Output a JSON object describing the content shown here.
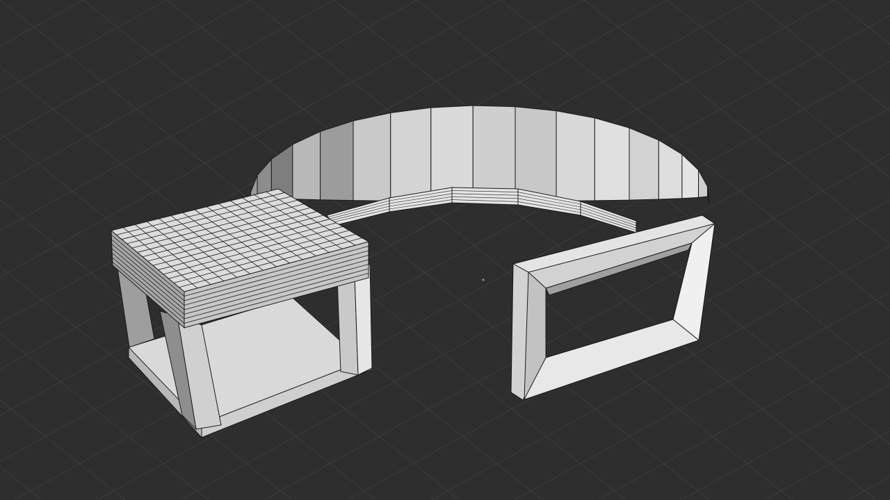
{
  "viewport": {
    "background": "#2e2e2e",
    "grid_line_color": "#3c3c3c"
  },
  "scene": {
    "objects": [
      "table",
      "curved-wall",
      "rectangular-frame"
    ],
    "mesh_face_light": "#d6d6d6",
    "mesh_face_mid": "#a8a8a8",
    "mesh_face_dark": "#7a7a7a",
    "wire_color": "#1a1a1a"
  }
}
